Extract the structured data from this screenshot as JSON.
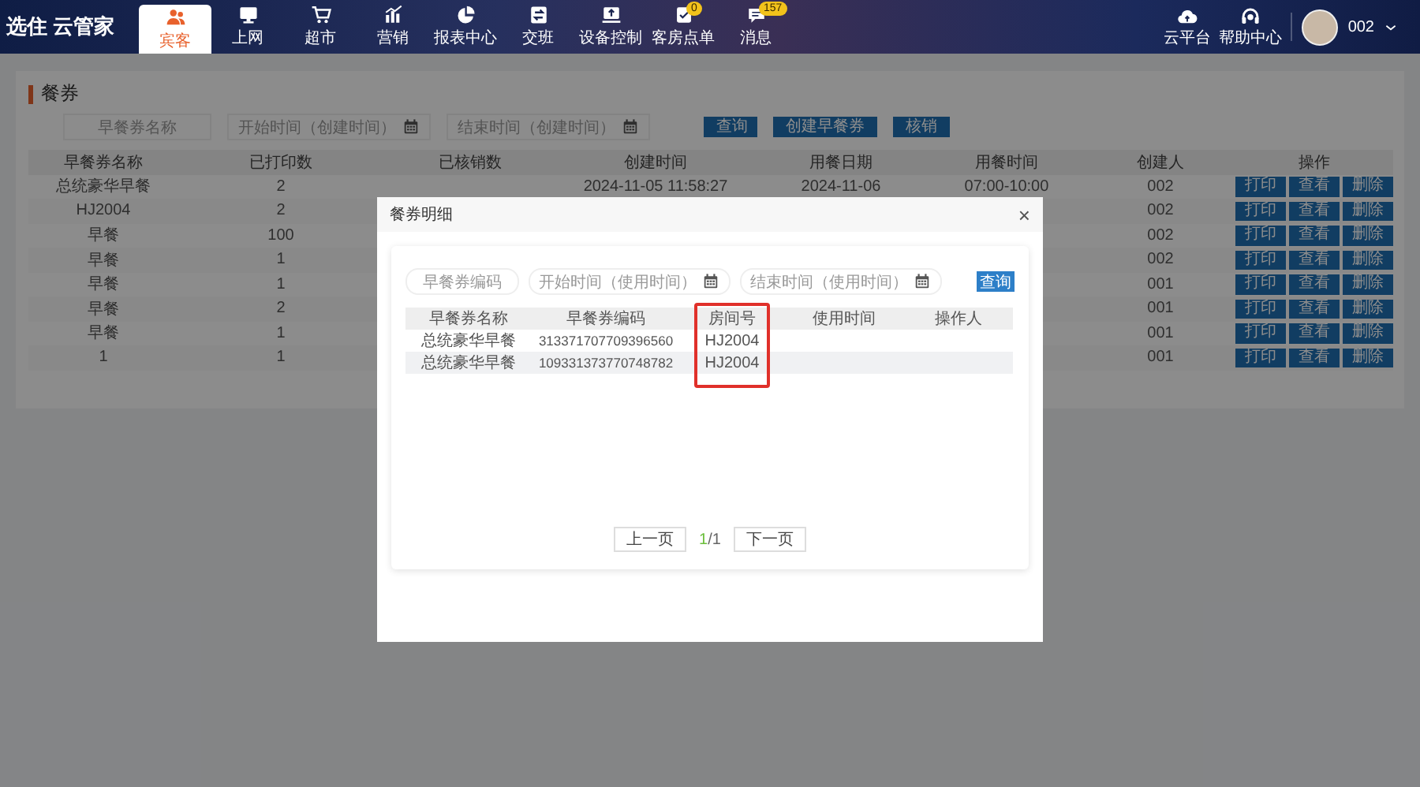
{
  "nav": {
    "logo": "选住 云管家",
    "tabs": [
      {
        "label": "宾客",
        "selected": true
      },
      {
        "label": "上网",
        "selected": false
      },
      {
        "label": "超市",
        "selected": false
      },
      {
        "label": "营销",
        "selected": false
      },
      {
        "label": "报表中心",
        "selected": false
      },
      {
        "label": "交班",
        "selected": false
      },
      {
        "label": "设备控制",
        "selected": false
      },
      {
        "label": "客房点单",
        "selected": false,
        "badge": "0"
      },
      {
        "label": "消息",
        "selected": false,
        "badge": "157"
      }
    ],
    "tools": [
      {
        "label": "云平台"
      },
      {
        "label": "帮助中心"
      }
    ],
    "user": {
      "name": "002"
    }
  },
  "page": {
    "title": "餐券",
    "filters": [
      {
        "kind": "text",
        "placeholder": "早餐券名称"
      },
      {
        "kind": "date",
        "placeholder": "开始时间（创建时间）"
      },
      {
        "kind": "date",
        "placeholder": "结束时间（创建时间）"
      }
    ],
    "buttons": [
      "查询",
      "创建早餐券",
      "核销"
    ],
    "table": {
      "columns": [
        "早餐券名称",
        "已打印数",
        "已核销数",
        "创建时间",
        "用餐日期",
        "用餐时间",
        "创建人",
        "操作"
      ],
      "rows": [
        {
          "name": "总统豪华早餐",
          "printed": "2",
          "created": "2024-11-05 11:58:27",
          "date": "2024-11-06",
          "time": "07:00-10:00",
          "creator": "002",
          "actions": [
            "打印",
            "查看",
            "删除"
          ]
        },
        {
          "name": "HJ2004",
          "printed": "2",
          "creator": "002",
          "actions": [
            "打印",
            "查看",
            "删除"
          ]
        },
        {
          "name": "早餐",
          "printed": "100",
          "creator": "002",
          "actions": [
            "打印",
            "查看",
            "删除"
          ]
        },
        {
          "name": "早餐",
          "printed": "1",
          "creator": "002",
          "actions": [
            "打印",
            "查看",
            "删除"
          ]
        },
        {
          "name": "早餐",
          "printed": "1",
          "creator": "001",
          "actions": [
            "打印",
            "查看",
            "删除"
          ]
        },
        {
          "name": "早餐",
          "printed": "2",
          "creator": "001",
          "actions": [
            "打印",
            "查看",
            "删除"
          ]
        },
        {
          "name": "早餐",
          "printed": "1",
          "creator": "001",
          "actions": [
            "打印",
            "查看",
            "删除"
          ]
        },
        {
          "name": "1",
          "printed": "1",
          "creator": "001",
          "actions": [
            "打印",
            "查看",
            "删除"
          ]
        }
      ]
    }
  },
  "modal": {
    "title": "餐券明细",
    "close": "×",
    "filters": [
      {
        "kind": "text",
        "placeholder": "早餐券编码"
      },
      {
        "kind": "date",
        "placeholder": "开始时间（使用时间）"
      },
      {
        "kind": "date",
        "placeholder": "结束时间（使用时间）"
      }
    ],
    "button": "查询",
    "table": {
      "columns": [
        {
          "label": "早餐券名称",
          "highlighted": false
        },
        {
          "label": "早餐券编码",
          "highlighted": false
        },
        {
          "label": "房间号",
          "highlighted": true
        },
        {
          "label": "使用时间",
          "highlighted": false
        },
        {
          "label": "操作人",
          "highlighted": false
        }
      ],
      "rows": [
        [
          "总统豪华早餐",
          "313371707709396560",
          "HJ2004"
        ],
        [
          "总统豪华早餐",
          "109331373770748782",
          "HJ2004"
        ]
      ]
    },
    "pager": {
      "prev": "上一页",
      "current": "1",
      "rest": "/1",
      "next": "下一页"
    }
  }
}
